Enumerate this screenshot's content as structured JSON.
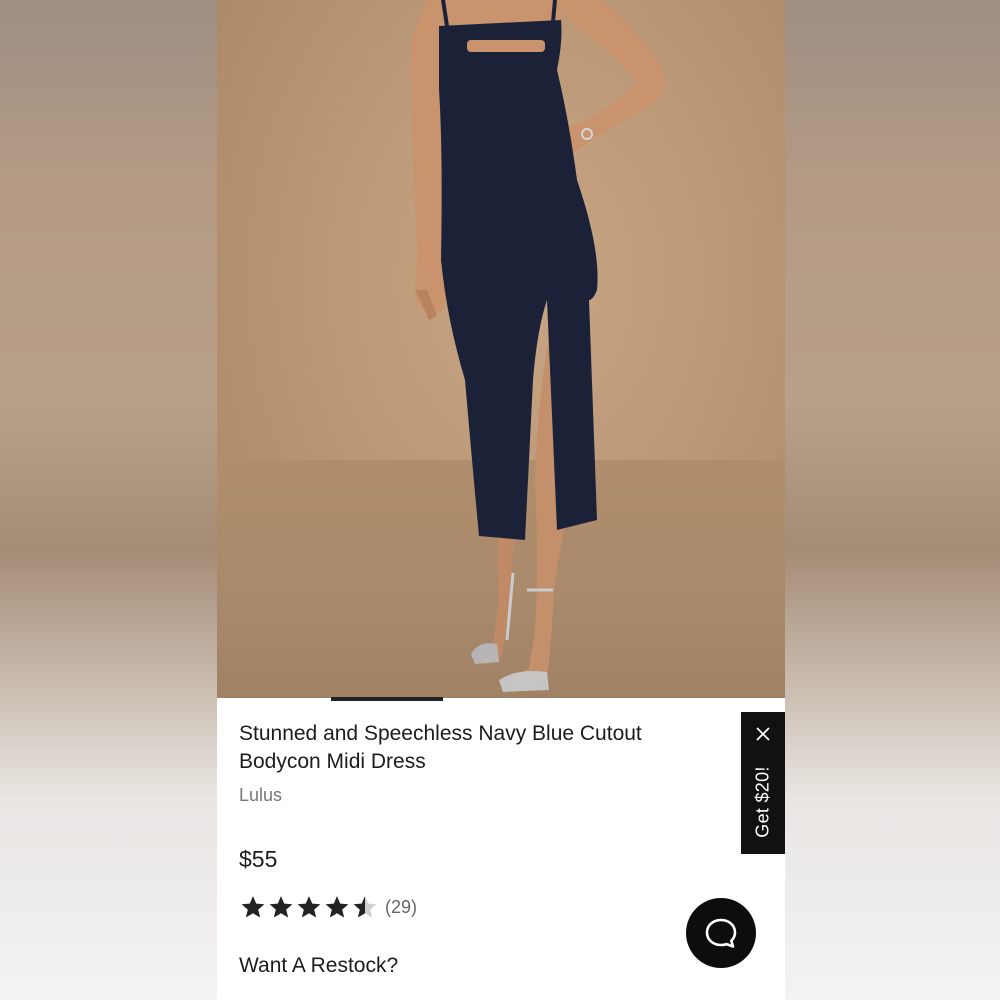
{
  "product": {
    "title": "Stunned and Speechless Navy Blue Cutout Bodycon Midi Dress",
    "brand": "Lulus",
    "price": "$55",
    "rating": {
      "value": 4.5,
      "max": 5,
      "count_label": "(29)"
    },
    "restock_label": "Want A Restock?"
  },
  "gallery": {
    "current_slide_indicator": "first"
  },
  "promo": {
    "label": "Get $20!"
  },
  "chat": {
    "icon": "chat-bubble-icon"
  },
  "colors": {
    "dress": "#1b2238",
    "backdrop": "#bb9877",
    "accent": "#111111",
    "star": "#222222"
  }
}
